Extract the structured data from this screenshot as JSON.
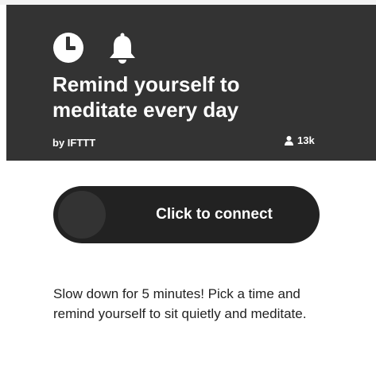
{
  "applet": {
    "icons": [
      "clock-icon",
      "bell-icon"
    ],
    "title": "Remind yourself to meditate every day",
    "author": "by IFTTT",
    "users_count": "13k",
    "connect_label": "Click to connect",
    "description": "Slow down for 5 minutes! Pick a time and remind yourself to sit quietly and meditate."
  },
  "colors": {
    "header_bg": "#333333",
    "button_bg": "#222222",
    "text_dark": "#222222",
    "text_light": "#ffffff"
  }
}
